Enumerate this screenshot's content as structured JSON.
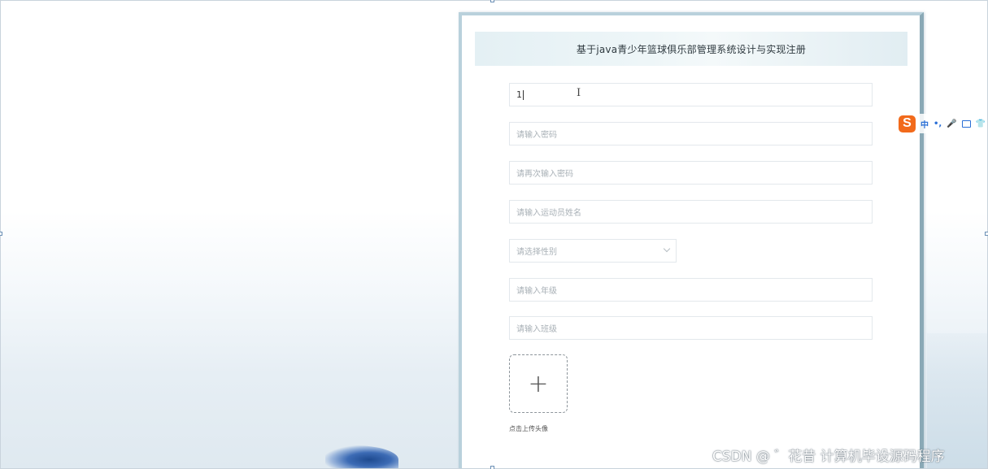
{
  "form": {
    "title": "基于java青少年篮球俱乐部管理系统设计与实现注册",
    "username": {
      "value": "1",
      "placeholder": ""
    },
    "password": {
      "placeholder": "请输入密码"
    },
    "confirm_password": {
      "placeholder": "请再次输入密码"
    },
    "athlete_name": {
      "placeholder": "请输入运动员姓名"
    },
    "gender": {
      "placeholder": "请选择性别"
    },
    "grade": {
      "placeholder": "请输入年级"
    },
    "class": {
      "placeholder": "请输入班级"
    },
    "avatar_upload": {
      "icon": "+",
      "hint": "点击上传头像"
    }
  },
  "ime_toolbar": {
    "logo": "S",
    "mode": "中",
    "punct": "•,",
    "mic": "🎤",
    "skin": "👕"
  },
  "watermark": "CSDN @ ゛花昔  计算机毕设源码程序",
  "colors": {
    "header_bg": "#e4f0f4",
    "card_border": "#b9d1dc",
    "ime_accent": "#2a6fd6",
    "ime_logo": "#f26a1b"
  }
}
